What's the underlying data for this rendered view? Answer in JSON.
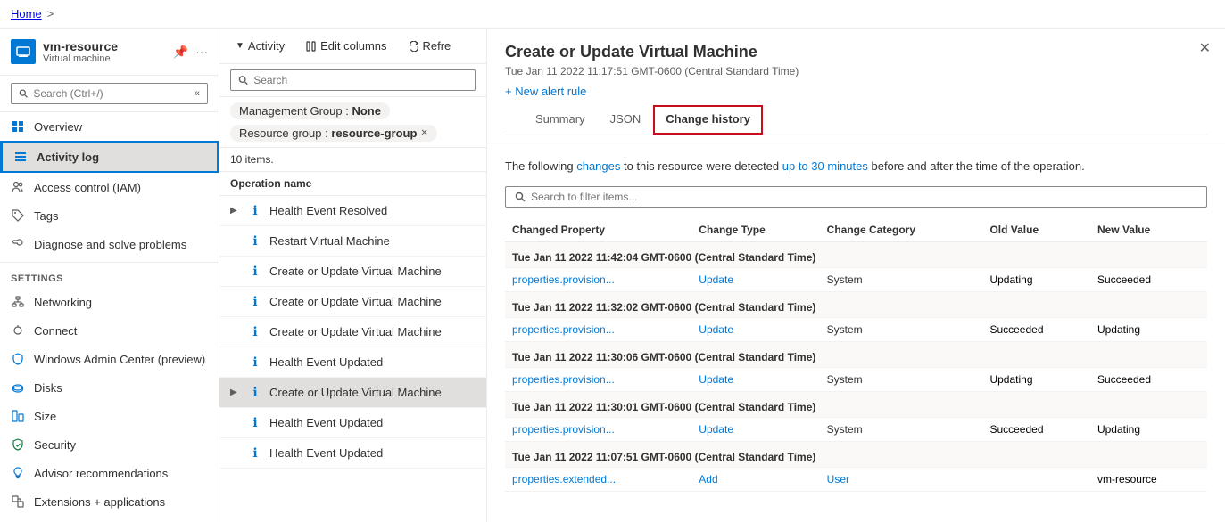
{
  "breadcrumb": {
    "home": "Home",
    "separator": ">"
  },
  "sidebar": {
    "resource_name": "vm-resource",
    "resource_type": "Virtual machine",
    "search_placeholder": "Search (Ctrl+/)",
    "collapse_icon": "«",
    "nav_items": [
      {
        "id": "overview",
        "label": "Overview",
        "icon": "grid"
      },
      {
        "id": "activity-log",
        "label": "Activity log",
        "icon": "list",
        "active": true
      },
      {
        "id": "access-control",
        "label": "Access control (IAM)",
        "icon": "people"
      },
      {
        "id": "tags",
        "label": "Tags",
        "icon": "tag"
      },
      {
        "id": "diagnose",
        "label": "Diagnose and solve problems",
        "icon": "wrench"
      }
    ],
    "settings_label": "Settings",
    "settings_items": [
      {
        "id": "networking",
        "label": "Networking",
        "icon": "network"
      },
      {
        "id": "connect",
        "label": "Connect",
        "icon": "plug"
      },
      {
        "id": "windows-admin",
        "label": "Windows Admin Center (preview)",
        "icon": "shield-admin"
      },
      {
        "id": "disks",
        "label": "Disks",
        "icon": "disk"
      },
      {
        "id": "size",
        "label": "Size",
        "icon": "resize"
      },
      {
        "id": "security",
        "label": "Security",
        "icon": "shield"
      },
      {
        "id": "advisor",
        "label": "Advisor recommendations",
        "icon": "lightbulb"
      },
      {
        "id": "extensions",
        "label": "Extensions + applications",
        "icon": "extension"
      }
    ]
  },
  "activity_panel": {
    "toolbar": {
      "activity_label": "Activity",
      "edit_columns_label": "Edit columns",
      "refresh_label": "Refre"
    },
    "search_placeholder": "Search",
    "filters": [
      {
        "label": "Management Group : ",
        "value": "None"
      },
      {
        "label": "Resource group : ",
        "value": "resource-group",
        "has_close": true
      }
    ],
    "items_count": "10 items.",
    "column_header": "Operation name",
    "list_items": [
      {
        "id": 1,
        "text": "Health Event Resolved",
        "has_arrow": true,
        "selected": false
      },
      {
        "id": 2,
        "text": "Restart Virtual Machine",
        "has_arrow": false,
        "selected": false
      },
      {
        "id": 3,
        "text": "Create or Update Virtual Machine",
        "has_arrow": false,
        "selected": false,
        "truncated": true
      },
      {
        "id": 4,
        "text": "Create or Update Virtual Machine",
        "has_arrow": false,
        "selected": false,
        "truncated": true
      },
      {
        "id": 5,
        "text": "Create or Update Virtual Machine",
        "has_arrow": false,
        "selected": false,
        "truncated": true
      },
      {
        "id": 6,
        "text": "Health Event Updated",
        "has_arrow": false,
        "selected": false
      },
      {
        "id": 7,
        "text": "Create or Update Virtual Machine",
        "has_arrow": true,
        "selected": true
      },
      {
        "id": 8,
        "text": "Health Event Updated",
        "has_arrow": false,
        "selected": false
      },
      {
        "id": 9,
        "text": "Health Event Updated",
        "has_arrow": false,
        "selected": false
      }
    ]
  },
  "detail_panel": {
    "title": "Create or Update Virtual Machine",
    "subtitle": "Tue Jan 11 2022 11:17:51 GMT-0600 (Central Standard Time)",
    "alert_link": "+ New alert rule",
    "tabs": [
      {
        "id": "summary",
        "label": "Summary",
        "active": false
      },
      {
        "id": "json",
        "label": "JSON",
        "active": false
      },
      {
        "id": "change-history",
        "label": "Change history",
        "active": true,
        "highlighted": true
      }
    ],
    "change_desc": "The following changes to this resource were detected up to 30 minutes before and after the time of the operation.",
    "search_placeholder": "Search to filter items...",
    "table": {
      "headers": [
        "Changed Property",
        "Change Type",
        "Change Category",
        "Old Value",
        "New Value"
      ],
      "groups": [
        {
          "date": "Tue Jan 11 2022 11:42:04 GMT-0600 (Central Standard Time)",
          "rows": [
            {
              "property": "properties.provision...",
              "change_type": "Update",
              "category": "System",
              "category_type": "system",
              "old_value": "Updating",
              "new_value": "Succeeded"
            }
          ]
        },
        {
          "date": "Tue Jan 11 2022 11:32:02 GMT-0600 (Central Standard Time)",
          "rows": [
            {
              "property": "properties.provision...",
              "change_type": "Update",
              "category": "System",
              "category_type": "system",
              "old_value": "Succeeded",
              "new_value": "Updating"
            }
          ]
        },
        {
          "date": "Tue Jan 11 2022 11:30:06 GMT-0600 (Central Standard Time)",
          "rows": [
            {
              "property": "properties.provision...",
              "change_type": "Update",
              "category": "System",
              "category_type": "system",
              "old_value": "Updating",
              "new_value": "Succeeded"
            }
          ]
        },
        {
          "date": "Tue Jan 11 2022 11:30:01 GMT-0600 (Central Standard Time)",
          "rows": [
            {
              "property": "properties.provision...",
              "change_type": "Update",
              "category": "System",
              "category_type": "system",
              "old_value": "Succeeded",
              "new_value": "Updating"
            }
          ]
        },
        {
          "date": "Tue Jan 11 2022 11:07:51 GMT-0600 (Central Standard Time)",
          "rows": [
            {
              "property": "properties.extended...",
              "change_type": "Add",
              "category": "User",
              "category_type": "user",
              "old_value": "",
              "new_value": "vm-resource"
            }
          ]
        }
      ]
    }
  }
}
